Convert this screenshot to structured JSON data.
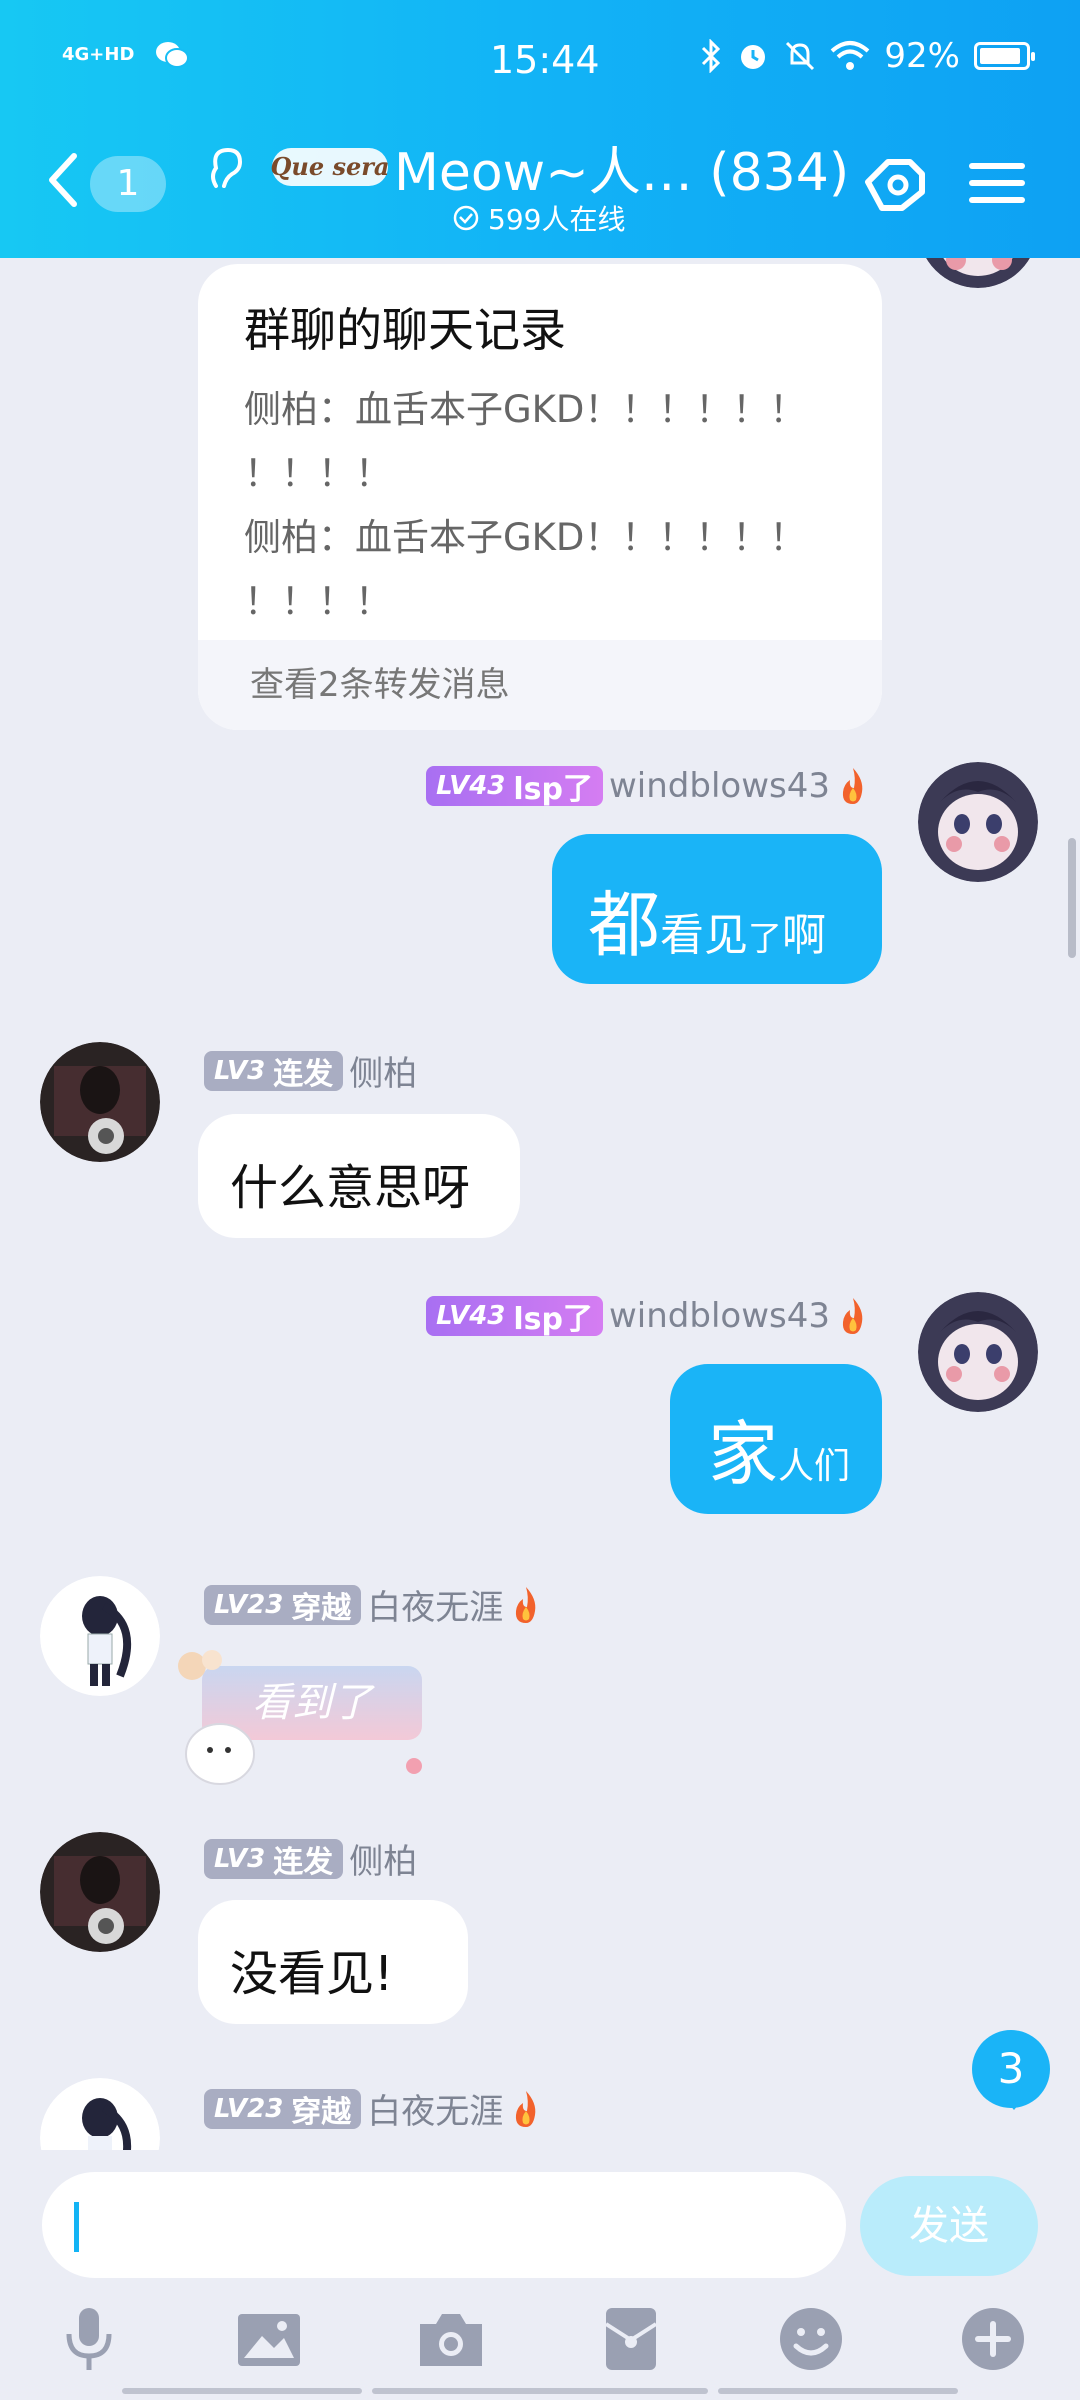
{
  "status_bar": {
    "network": "4G+HD",
    "time": "15:44",
    "battery": "92%"
  },
  "header": {
    "unread": "1",
    "logo_text": "Que sera",
    "group_name": "Meow~人… (834)",
    "online": "599人在线"
  },
  "forward": {
    "title": "群聊的聊天记录",
    "line1a": "侧柏：血舌本子GKD！！！！！！",
    "line1b": "！！！！",
    "line2a": "侧柏：血舌本子GKD！！！！！！",
    "line2b": "！！！！",
    "footer": "查看2条转发消息"
  },
  "messages": [
    {
      "level": "LV43",
      "title": "lsp了",
      "name": "windblows43",
      "big": "都",
      "rest1": "看见",
      "rest2": "了",
      "rest3": "啊"
    },
    {
      "level": "LV3",
      "title": "连发",
      "name": "侧柏",
      "text": "什么意思呀"
    },
    {
      "level": "LV43",
      "title": "lsp了",
      "name": "windblows43",
      "big": "家",
      "rest1": "人们"
    },
    {
      "level": "LV23",
      "title": "穿越",
      "name": "白夜无涯",
      "sticker": "看到了"
    },
    {
      "level": "LV3",
      "title": "连发",
      "name": "侧柏",
      "text": "没看见!"
    },
    {
      "level": "LV23",
      "title": "穿越",
      "name": "白夜无涯"
    }
  ],
  "new_badge": "3",
  "input": {
    "send": "发送"
  },
  "colors": {
    "accent": "#1ab4f7",
    "header_start": "#17c8f3",
    "background": "#ebedf5"
  }
}
